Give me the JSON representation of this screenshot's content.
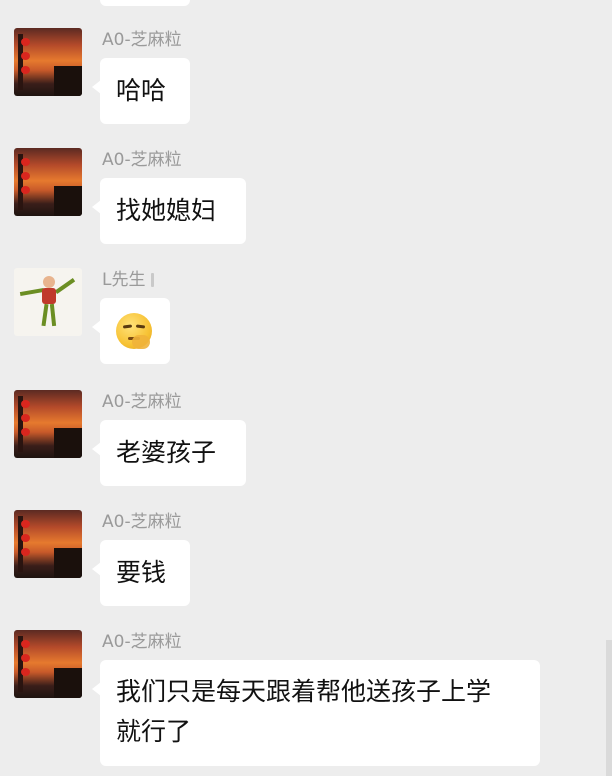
{
  "messages": [
    {
      "sender": "A0-芝麻粒",
      "avatar": "sunset-avatar",
      "text": "哈哈"
    },
    {
      "sender": "A0-芝麻粒",
      "avatar": "sunset-avatar",
      "text": "找她媳妇"
    },
    {
      "sender": "L先生",
      "avatar": "doll-avatar",
      "emoji": "thinking-face-icon"
    },
    {
      "sender": "A0-芝麻粒",
      "avatar": "sunset-avatar",
      "text": "老婆孩子"
    },
    {
      "sender": "A0-芝麻粒",
      "avatar": "sunset-avatar",
      "text": "要钱"
    },
    {
      "sender": "A0-芝麻粒",
      "avatar": "sunset-avatar",
      "text_line1": "我们只是每天跟着帮他送孩子上学",
      "text_line2": "就行了"
    }
  ],
  "colors": {
    "background": "#ededed",
    "bubble": "#ffffff",
    "sender_name": "#9a9a9a",
    "message_text": "#111111"
  }
}
